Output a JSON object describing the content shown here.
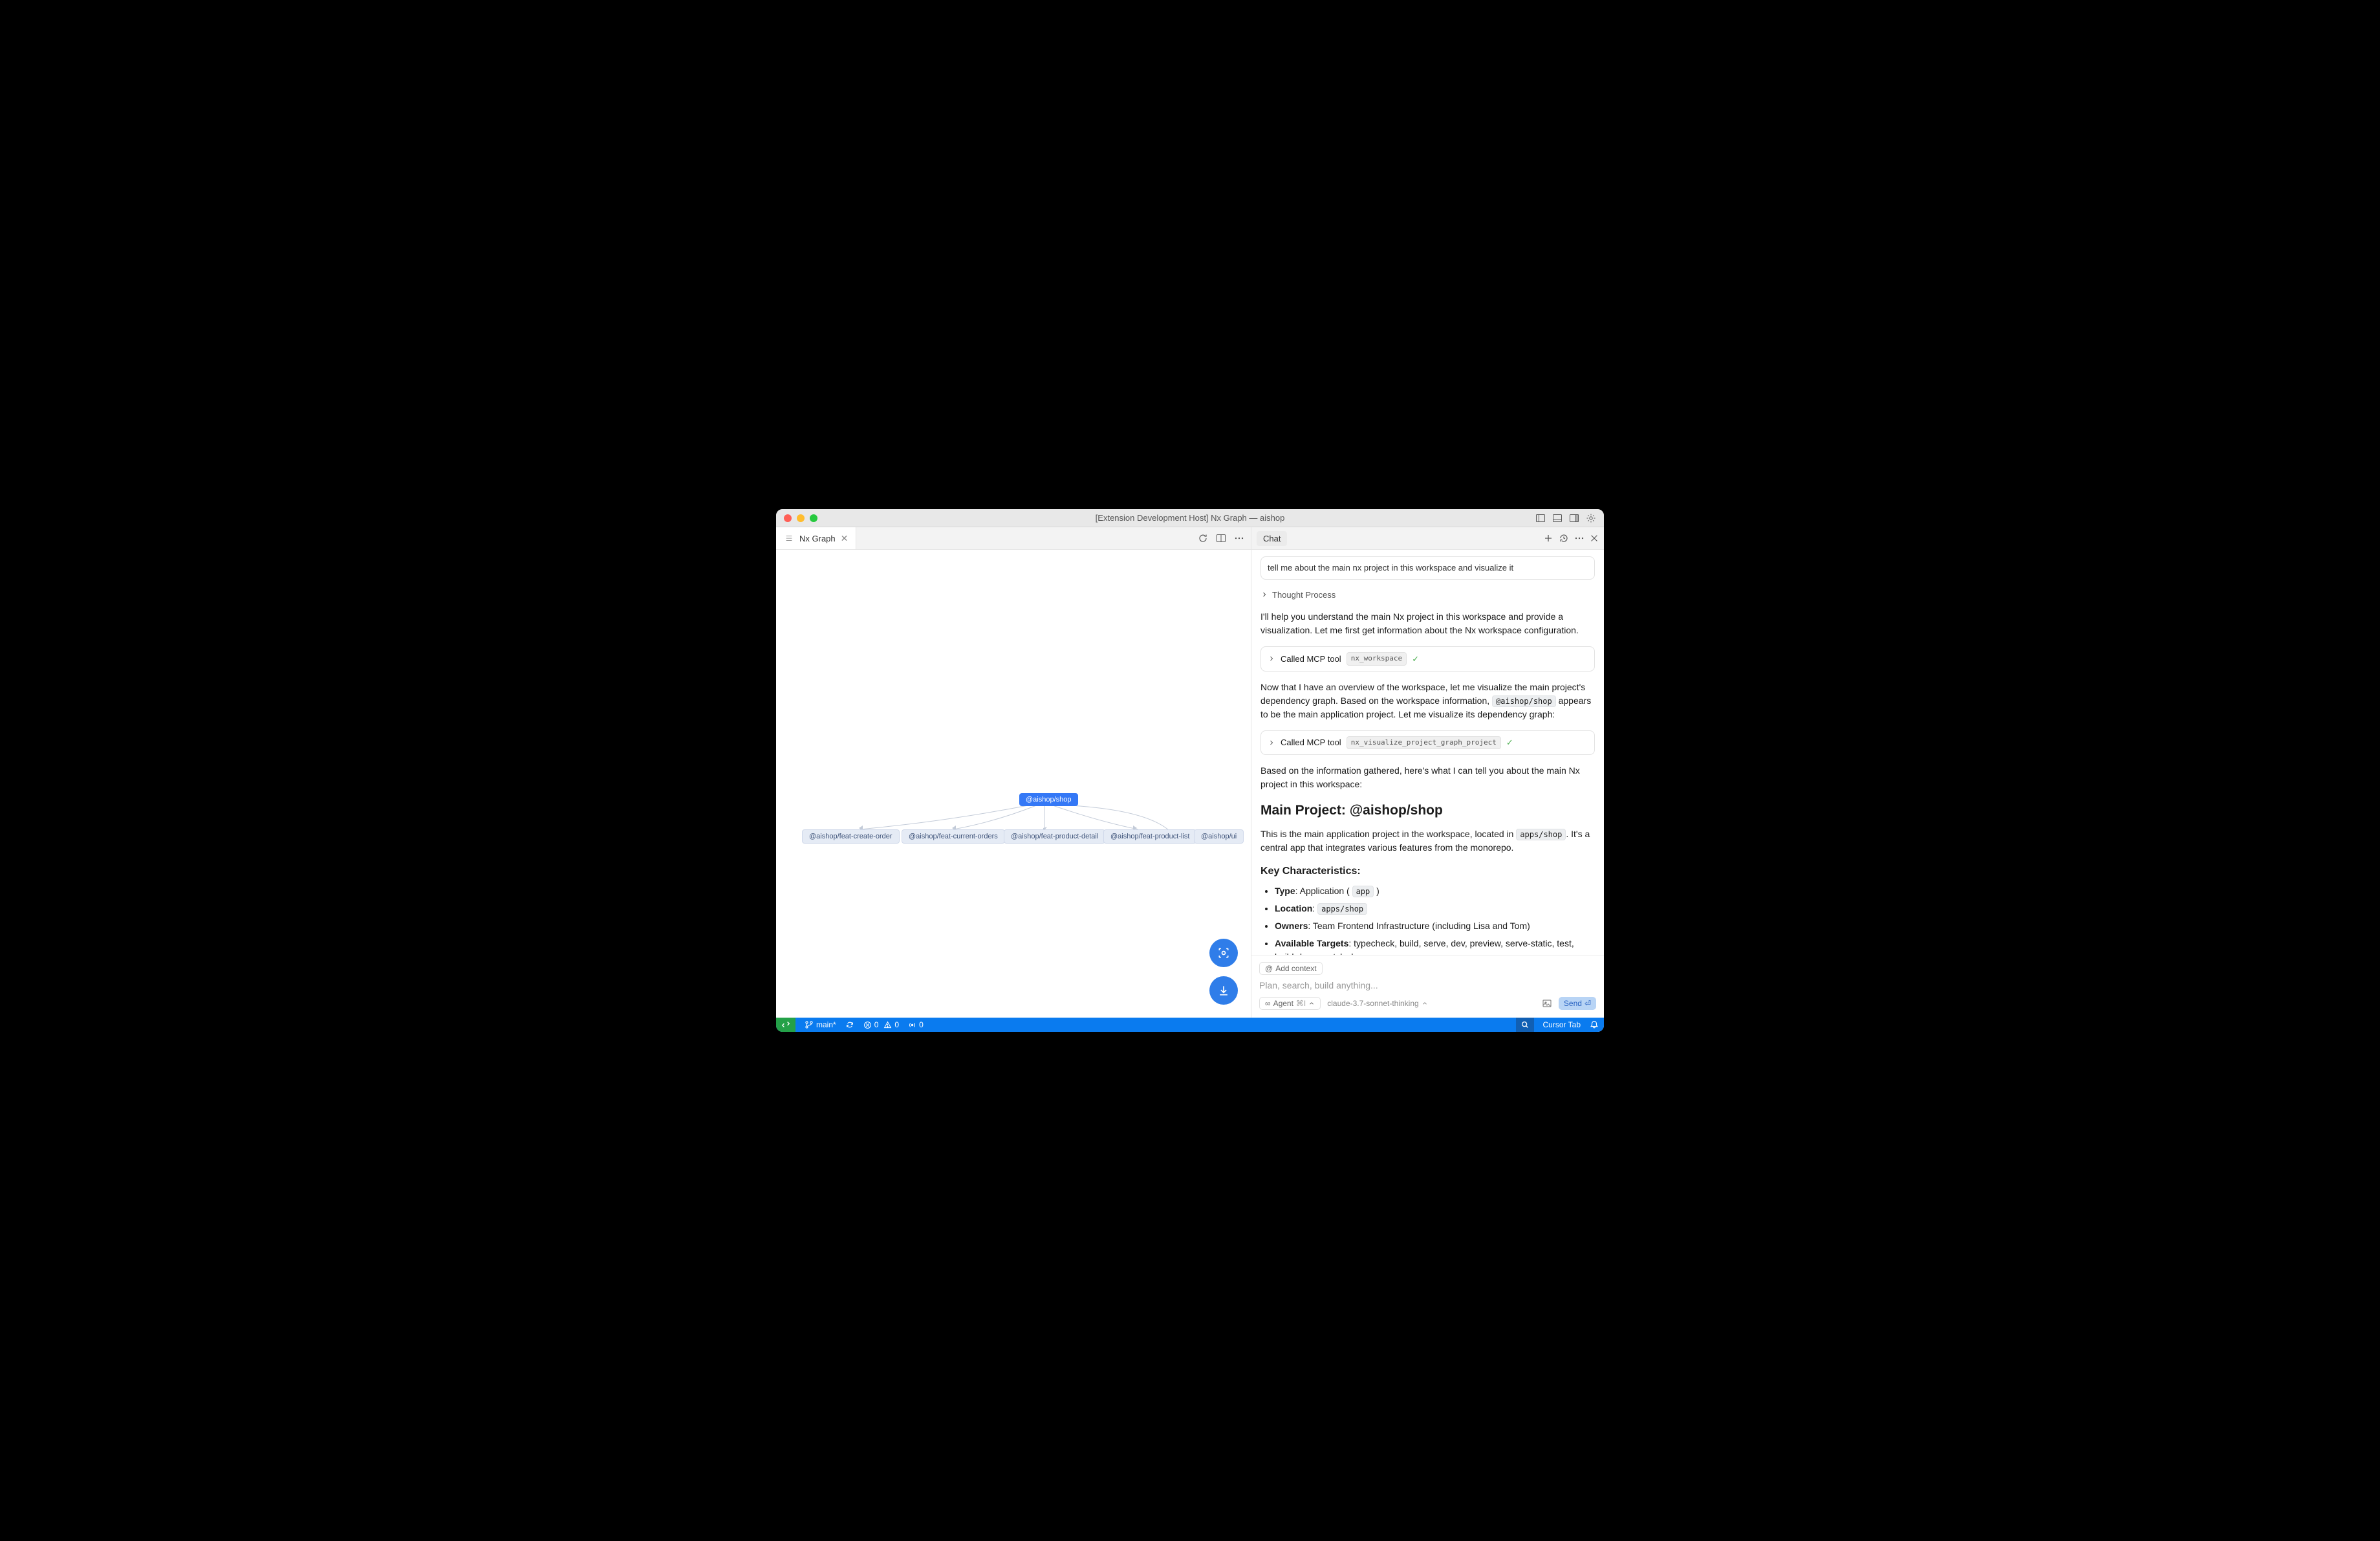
{
  "window": {
    "title": "[Extension Development Host] Nx Graph — aishop"
  },
  "editor": {
    "tab_label": "Nx Graph",
    "graph": {
      "root": "@aishop/shop",
      "deps": [
        "@aishop/feat-create-order",
        "@aishop/feat-current-orders",
        "@aishop/feat-product-detail",
        "@aishop/feat-product-list",
        "@aishop/ui"
      ]
    }
  },
  "chat": {
    "tab_label": "Chat",
    "user_prompt": "tell me about the main nx project in this workspace and visualize it",
    "thought_label": "Thought Process",
    "p1": "I'll help you understand the main Nx project in this workspace and provide a visualization. Let me first get information about the Nx workspace configuration.",
    "tool_called_label": "Called MCP tool",
    "tool1": "nx_workspace",
    "p2a": "Now that I have an overview of the workspace, let me visualize the main project's dependency graph. Based on the workspace information, ",
    "p2_code": "@aishop/shop",
    "p2b": " appears to be the main application project. Let me visualize its dependency graph:",
    "tool2": "nx_visualize_project_graph_project",
    "p3": "Based on the information gathered, here's what I can tell you about the main Nx project in this workspace:",
    "h2": "Main Project: @aishop/shop",
    "p4a": "This is the main application project in the workspace, located in ",
    "p4_code": "apps/shop",
    "p4b": ". It's a central app that integrates various features from the monorepo.",
    "h3": "Key Characteristics:",
    "li_type_label": "Type",
    "li_type_value": ": Application ( ",
    "li_type_code": "app",
    "li_type_close": " )",
    "li_location_label": "Location",
    "li_location_sep": ": ",
    "li_location_code": "apps/shop",
    "li_owners_label": "Owners",
    "li_owners_value": ": Team Frontend Infrastructure (including Lisa and Tom)",
    "li_targets_label": "Available Targets",
    "li_targets_value": ": typecheck, build, serve, dev, preview, serve-static, test, build-deps, watch-deps",
    "add_context": "Add context",
    "input_placeholder": "Plan, search, build anything...",
    "agent_label": "Agent",
    "agent_shortcut": "⌘I",
    "model": "claude-3.7-sonnet-thinking",
    "send": "Send"
  },
  "statusbar": {
    "branch": "main*",
    "errors": "0",
    "warnings": "0",
    "ports": "0",
    "cursor_tab": "Cursor Tab"
  }
}
